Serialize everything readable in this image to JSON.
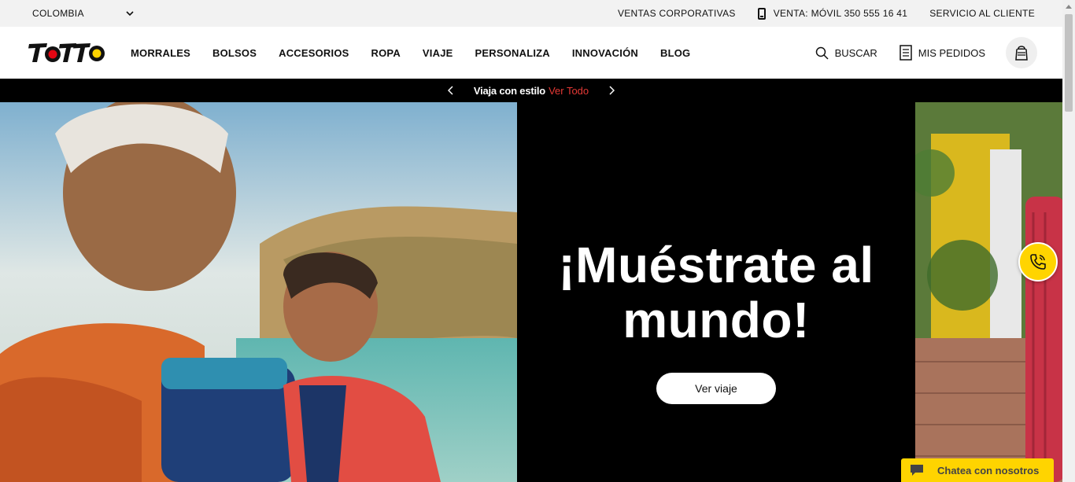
{
  "topbar": {
    "country": "COLOMBIA",
    "links": [
      {
        "label": "VENTAS CORPORATIVAS"
      },
      {
        "label": "VENTA: MÓVIL 350 555 16 41"
      },
      {
        "label": "SERVICIO AL CLIENTE"
      }
    ]
  },
  "header": {
    "logo": "TOTTO",
    "nav": [
      "MORRALES",
      "BOLSOS",
      "ACCESORIOS",
      "ROPA",
      "VIAJE",
      "PERSONALIZA",
      "INNOVACIÓN",
      "BLOG"
    ],
    "search_label": "BUSCAR",
    "orders_label": "MIS PEDIDOS"
  },
  "promo": {
    "text": "Viaja con estilo",
    "link": "Ver Todo"
  },
  "hero": {
    "headline_line1": "¡Muéstrate al",
    "headline_line2": "mundo!",
    "cta": "Ver viaje"
  },
  "chat": {
    "label": "Chatea con nosotros"
  },
  "colors": {
    "accent_yellow": "#ffd400",
    "promo_link_red": "#e53935",
    "logo_red": "#e30613"
  },
  "icons": [
    "chevron-down-icon",
    "phone-icon",
    "search-icon",
    "orders-icon",
    "bag-icon",
    "chevron-left-icon",
    "chevron-right-icon",
    "call-icon",
    "chat-icon"
  ]
}
